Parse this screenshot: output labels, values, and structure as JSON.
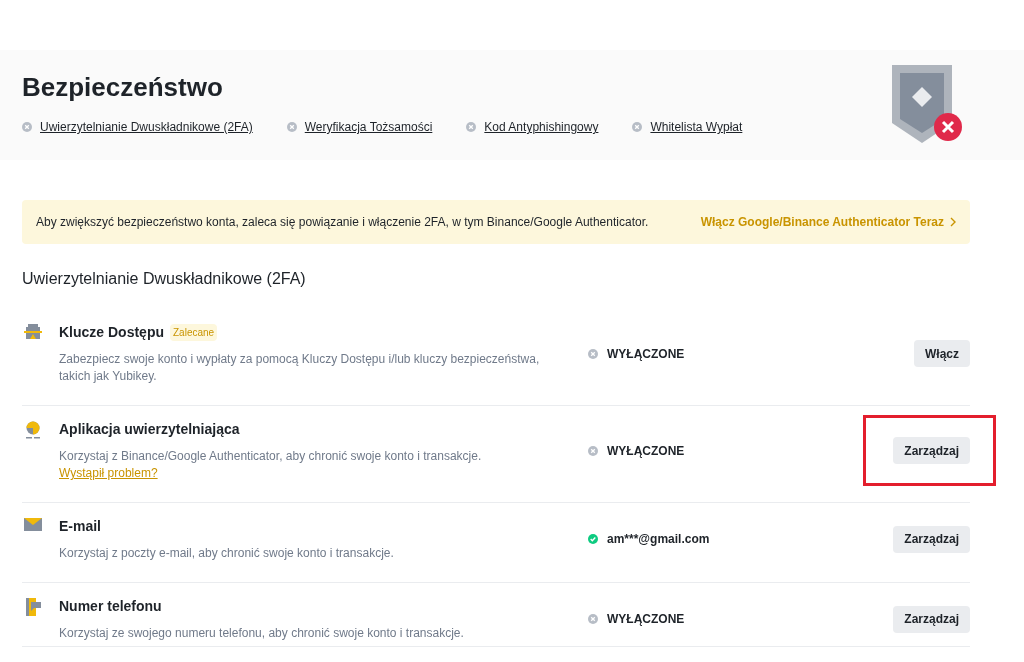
{
  "header": {
    "title": "Bezpieczeństwo",
    "links": [
      {
        "label": "Uwierzytelnianie Dwuskładnikowe (2FA)",
        "done": false
      },
      {
        "label": "Weryfikacja Tożsamości",
        "done": false
      },
      {
        "label": "Kod Antyphishingowy",
        "done": false
      },
      {
        "label": "Whitelista Wypłat",
        "done": false
      }
    ],
    "shield_secure": false
  },
  "banner": {
    "text": "Aby zwiększyć bezpieczeństwo konta, zaleca się powiązanie i włączenie 2FA, w tym Binance/Google Authenticator.",
    "action": "Włącz Google/Binance Authenticator Teraz"
  },
  "section_title": "Uwierzytelnianie Dwuskładnikowe (2FA)",
  "methods": [
    {
      "kind": "passkey",
      "name": "Klucze Dostępu",
      "badge": "Zalecane",
      "description": "Zabezpiecz swoje konto i wypłaty za pomocą Kluczy Dostępu i/lub kluczy bezpieczeństwa, takich jak Yubikey.",
      "status": "WYŁĄCZONE",
      "enabled": false,
      "button": "Włącz",
      "highlighted": false
    },
    {
      "kind": "authenticator",
      "name": "Aplikacja uwierzytelniająca",
      "description": "Korzystaj z Binance/Google Authenticator, aby chronić swoje konto i transakcje.",
      "link": "Wystąpił problem?",
      "status": "WYŁĄCZONE",
      "enabled": false,
      "button": "Zarządzaj",
      "highlighted": true
    },
    {
      "kind": "email",
      "name": "E-mail",
      "description": "Korzystaj z poczty e-mail, aby chronić swoje konto i transakcje.",
      "status": "am***@gmail.com",
      "enabled": true,
      "button": "Zarządzaj",
      "highlighted": false
    },
    {
      "kind": "phone",
      "name": "Numer telefonu",
      "description": "Korzystaj ze swojego numeru telefonu, aby chronić swoje konto i transakcje.",
      "status": "WYŁĄCZONE",
      "enabled": false,
      "button": "Zarządzaj",
      "highlighted": false
    }
  ]
}
